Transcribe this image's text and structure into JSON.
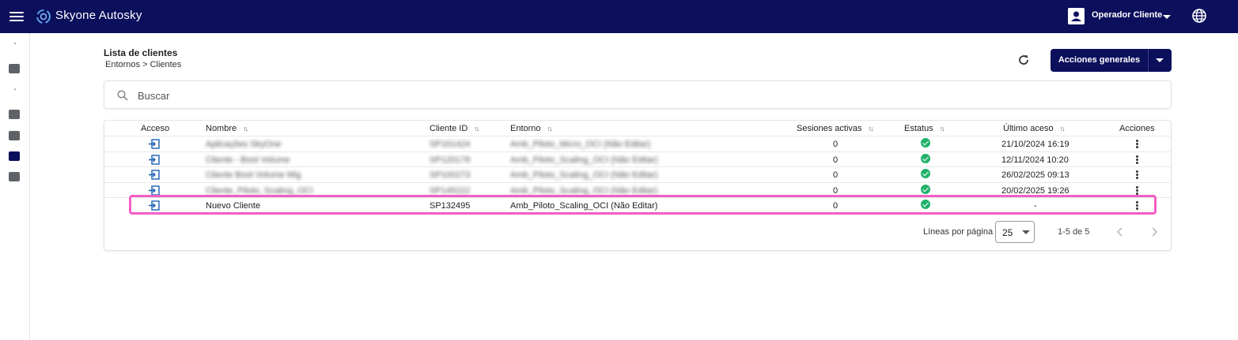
{
  "app": {
    "brand": "Skyone Autosky"
  },
  "user": {
    "name": "Operador Cliente"
  },
  "sidebar": {
    "dash1": "-",
    "dash2": "-"
  },
  "header": {
    "title": "Lista de clientes",
    "breadcrumb": "Entornos > Clientes"
  },
  "toolbar": {
    "actions_label": "Acciones generales"
  },
  "search": {
    "placeholder": "Buscar"
  },
  "table": {
    "columns": {
      "acceso": "Acceso",
      "nombre": "Nombre",
      "cliente_id": "Cliente ID",
      "entorno": "Entorno",
      "sesiones": "Sesiones activas",
      "estatus": "Estatus",
      "ultimo_acceso": "Último aceso",
      "acciones": "Acciones"
    },
    "rows": [
      {
        "nombre": "Aplicações SkyOne",
        "cliente_id": "SP161424",
        "entorno": "Amb_Piloto_Micro_OCI (Não Editar)",
        "sesiones": "0",
        "ultimo_acceso": "21/10/2024 16:19"
      },
      {
        "nombre": "Cliente - Boot Volume",
        "cliente_id": "SP120178",
        "entorno": "Amb_Piloto_Scaling_OCI (Não Editar)",
        "sesiones": "0",
        "ultimo_acceso": "12/11/2024 10:20"
      },
      {
        "nombre": "Cliente Boot Volume Mig",
        "cliente_id": "SP100273",
        "entorno": "Amb_Piloto_Scaling_OCI (Não Editar)",
        "sesiones": "0",
        "ultimo_acceso": "26/02/2025 09:13"
      },
      {
        "nombre": "Cliente_Piloto_Scaling_OCI",
        "cliente_id": "SP145222",
        "entorno": "Amb_Piloto_Scaling_OCI (Não Editar)",
        "sesiones": "0",
        "ultimo_acceso": "20/02/2025 19:26"
      },
      {
        "nombre": "Nuevo Cliente",
        "cliente_id": "SP132495",
        "entorno": "Amb_Piloto_Scaling_OCI (Não Editar)",
        "sesiones": "0",
        "ultimo_acceso": "-"
      }
    ]
  },
  "pagination": {
    "label": "Líneas por página",
    "per_page": "25",
    "range": "1-5 de 5"
  },
  "colors": {
    "primary": "#0b0f5c",
    "status_ok": "#21b26b",
    "highlight": "#f35ec5"
  }
}
